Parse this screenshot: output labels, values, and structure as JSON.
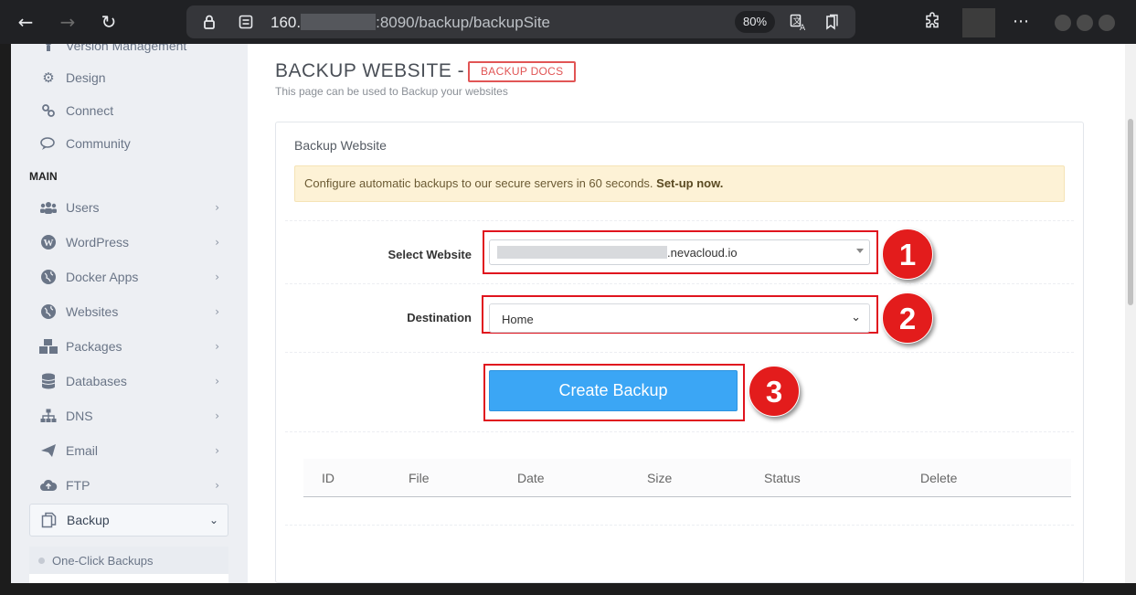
{
  "browser": {
    "url_host_start": "160.",
    "url_rest": ":8090/backup/backupSite",
    "zoom": "80%",
    "icons": [
      "back-arrow-icon",
      "forward-arrow-icon",
      "reload-icon",
      "lock-icon",
      "site-settings-icon",
      "translate-icon",
      "reading-list-icon",
      "extensions-icon",
      "more-icon"
    ]
  },
  "sidebar": {
    "top_items": [
      {
        "label": "Version Management",
        "icon": "person-icon"
      },
      {
        "label": "Design",
        "icon": "gear-icon"
      },
      {
        "label": "Connect",
        "icon": "link-icon"
      },
      {
        "label": "Community",
        "icon": "chat-icon"
      }
    ],
    "section_title": "MAIN",
    "items": [
      {
        "label": "Users",
        "icon": "users-icon",
        "chevron": "›"
      },
      {
        "label": "WordPress",
        "icon": "wordpress-icon",
        "chevron": "›"
      },
      {
        "label": "Docker Apps",
        "icon": "globe-icon",
        "chevron": "›"
      },
      {
        "label": "Websites",
        "icon": "globe-icon",
        "chevron": "›"
      },
      {
        "label": "Packages",
        "icon": "cubes-icon",
        "chevron": "›"
      },
      {
        "label": "Databases",
        "icon": "database-icon",
        "chevron": "›"
      },
      {
        "label": "DNS",
        "icon": "sitemap-icon",
        "chevron": "›"
      },
      {
        "label": "Email",
        "icon": "paper-plane-icon",
        "chevron": "›"
      },
      {
        "label": "FTP",
        "icon": "cloud-upload-icon",
        "chevron": "›"
      },
      {
        "label": "Backup",
        "icon": "copy-icon",
        "chevron": "⌄"
      }
    ],
    "sub_items": [
      {
        "label": "One-Click Backups"
      }
    ]
  },
  "main": {
    "title": "BACKUP WEBSITE -",
    "docs_badge": "BACKUP DOCS",
    "subtitle": "This page can be used to Backup your websites",
    "card_title": "Backup Website",
    "alert_text": "Configure automatic backups to our secure servers in 60 seconds. ",
    "alert_link": "Set-up now.",
    "select_website_label": "Select Website",
    "select_website_value": ".nevacloud.io",
    "destination_label": "Destination",
    "destination_value": "Home",
    "create_button": "Create Backup",
    "steps": [
      "1",
      "2",
      "3"
    ],
    "table_headers": [
      "ID",
      "File",
      "Date",
      "Size",
      "Status",
      "Delete"
    ]
  },
  "colors": {
    "accent": "#3ba6f5",
    "annotation_red": "#e31c1c",
    "alert_bg": "#fdf2d6"
  }
}
